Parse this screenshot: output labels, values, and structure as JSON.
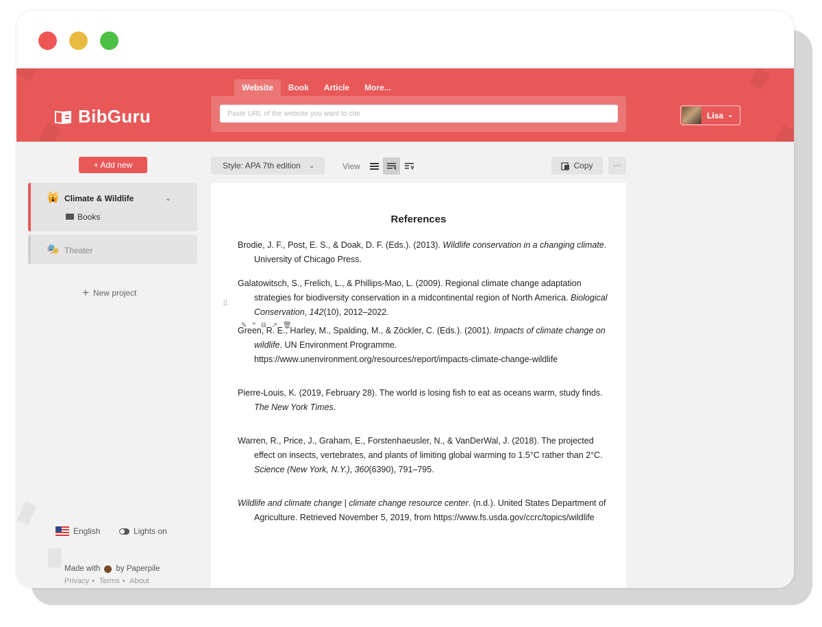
{
  "window": {
    "title": "BibGuru"
  },
  "header": {
    "brand": "BibGuru",
    "tabs": [
      {
        "label": "Website",
        "active": true
      },
      {
        "label": "Book",
        "active": false
      },
      {
        "label": "Article",
        "active": false
      },
      {
        "label": "More...",
        "active": false
      }
    ],
    "url_placeholder": "Paste URL of the website you want to cite",
    "user_name": "Lisa"
  },
  "sidebar": {
    "add_new": "+ Add new",
    "projects": [
      {
        "name": "Climate & Wildlife",
        "icon": "🙀",
        "active": true,
        "folders": [
          "Books"
        ]
      },
      {
        "name": "Theater",
        "icon": "🎭",
        "active": false
      }
    ],
    "new_project": "New project",
    "language": "English",
    "lights": "Lights on",
    "made_with_prefix": "Made with",
    "made_with_suffix": "by Paperpile",
    "footer_links": [
      "Privacy",
      "Terms",
      "About"
    ]
  },
  "toolbar": {
    "style_label": "Style: APA 7th edition",
    "view_label": "View",
    "copy_label": "Copy",
    "more_label": "···"
  },
  "document": {
    "title": "References",
    "references": [
      {
        "parts": [
          {
            "t": "Brodie, J. F., Post, E. S., & Doak, D. F. (Eds.). (2013). "
          },
          {
            "t": "Wildlife conservation in a changing climate",
            "i": true
          },
          {
            "t": ". University of Chicago Press."
          }
        ]
      },
      {
        "parts": [
          {
            "t": "Galatowitsch, S., Frelich, L., & Phillips-Mao, L. (2009). Regional climate change adaptation strategies for biodiversity conservation in a midcontinental region of North America. "
          },
          {
            "t": "Biological Conservation",
            "i": true
          },
          {
            "t": ", "
          },
          {
            "t": "142",
            "i": true
          },
          {
            "t": "(10), 2012–2022."
          }
        ]
      },
      {
        "parts": [
          {
            "t": "Green, R. E., Harley, M., Spalding, M., & Zöckler, C. (Eds.). (2001). "
          },
          {
            "t": "Impacts of climate change on wildlife",
            "i": true
          },
          {
            "t": ". UN Environment Programme. https://www.unenvironment.org/resources/report/impacts-climate-change-wildlife"
          }
        ]
      },
      {
        "parts": [
          {
            "t": "Pierre-Louis, K. (2019, February 28). The world is losing fish to eat as oceans warm, study finds. "
          },
          {
            "t": "The New York Times",
            "i": true
          },
          {
            "t": "."
          }
        ]
      },
      {
        "parts": [
          {
            "t": "Warren, R., Price, J., Graham, E., Forstenhaeusler, N., & VanDerWal, J. (2018). The projected effect on insects, vertebrates, and plants of limiting global warming to 1.5°C rather than 2°C. "
          },
          {
            "t": "Science (New York, N.Y.)",
            "i": true
          },
          {
            "t": ", "
          },
          {
            "t": "360",
            "i": true
          },
          {
            "t": "(6390), 791–795."
          }
        ]
      },
      {
        "parts": [
          {
            "t": "Wildlife and climate change | climate change resource center",
            "i": true
          },
          {
            "t": ". (n.d.). United States Department of Agriculture. Retrieved November 5, 2019, from https://www.fs.usda.gov/ccrc/topics/wildlife"
          }
        ]
      }
    ]
  },
  "colors": {
    "brand": "#e85858",
    "sidebar_bg": "#f2f2f2"
  }
}
